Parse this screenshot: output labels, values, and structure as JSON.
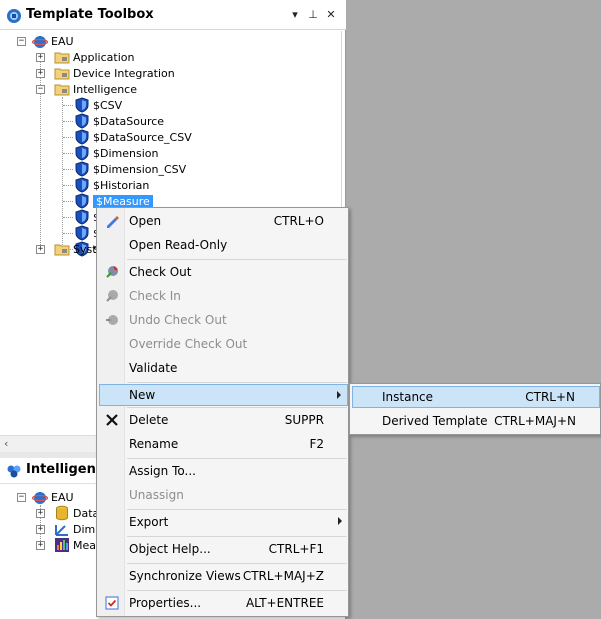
{
  "toolbox": {
    "title": "Template Toolbox",
    "buttons": {
      "dropdown": "▾",
      "pin": "⊥",
      "close": "✕"
    },
    "tree": {
      "root": "EAU",
      "items": [
        {
          "label": "Application"
        },
        {
          "label": "Device Integration"
        },
        {
          "label": "Intelligence"
        },
        {
          "label": "$CSV"
        },
        {
          "label": "$DataSource"
        },
        {
          "label": "$DataSource_CSV"
        },
        {
          "label": "$Dimension"
        },
        {
          "label": "$Dimension_CSV"
        },
        {
          "label": "$Historian"
        },
        {
          "label": "$Measure"
        },
        {
          "label": "$"
        },
        {
          "label": "$"
        },
        {
          "label": "$"
        },
        {
          "label": "Syst"
        }
      ]
    }
  },
  "intelligence_panel": {
    "title": "Intelligence",
    "tree": {
      "root": "EAU",
      "items": [
        {
          "label": "Data"
        },
        {
          "label": "Dim"
        },
        {
          "label": "Mea"
        }
      ]
    }
  },
  "context_menu": {
    "items": [
      {
        "label": "Open",
        "shortcut": "CTRL+O"
      },
      {
        "label": "Open Read-Only",
        "shortcut": ""
      },
      {
        "label": "Check Out",
        "shortcut": ""
      },
      {
        "label": "Check In",
        "shortcut": ""
      },
      {
        "label": "Undo Check Out",
        "shortcut": ""
      },
      {
        "label": "Override Check Out",
        "shortcut": ""
      },
      {
        "label": "Validate",
        "shortcut": ""
      },
      {
        "label": "New",
        "shortcut": ""
      },
      {
        "label": "Delete",
        "shortcut": "SUPPR"
      },
      {
        "label": "Rename",
        "shortcut": "F2"
      },
      {
        "label": "Assign To...",
        "shortcut": ""
      },
      {
        "label": "Unassign",
        "shortcut": ""
      },
      {
        "label": "Export",
        "shortcut": ""
      },
      {
        "label": "Object Help...",
        "shortcut": "CTRL+F1"
      },
      {
        "label": "Synchronize Views",
        "shortcut": "CTRL+MAJ+Z"
      },
      {
        "label": "Properties...",
        "shortcut": "ALT+ENTREE"
      }
    ]
  },
  "new_submenu": {
    "items": [
      {
        "label": "Instance",
        "shortcut": "CTRL+N"
      },
      {
        "label": "Derived Template",
        "shortcut": "CTRL+MAJ+N"
      }
    ]
  },
  "colors": {
    "selection": "#3399ff",
    "menu_highlight": "#cce4f7",
    "workspace": "#ababab"
  }
}
